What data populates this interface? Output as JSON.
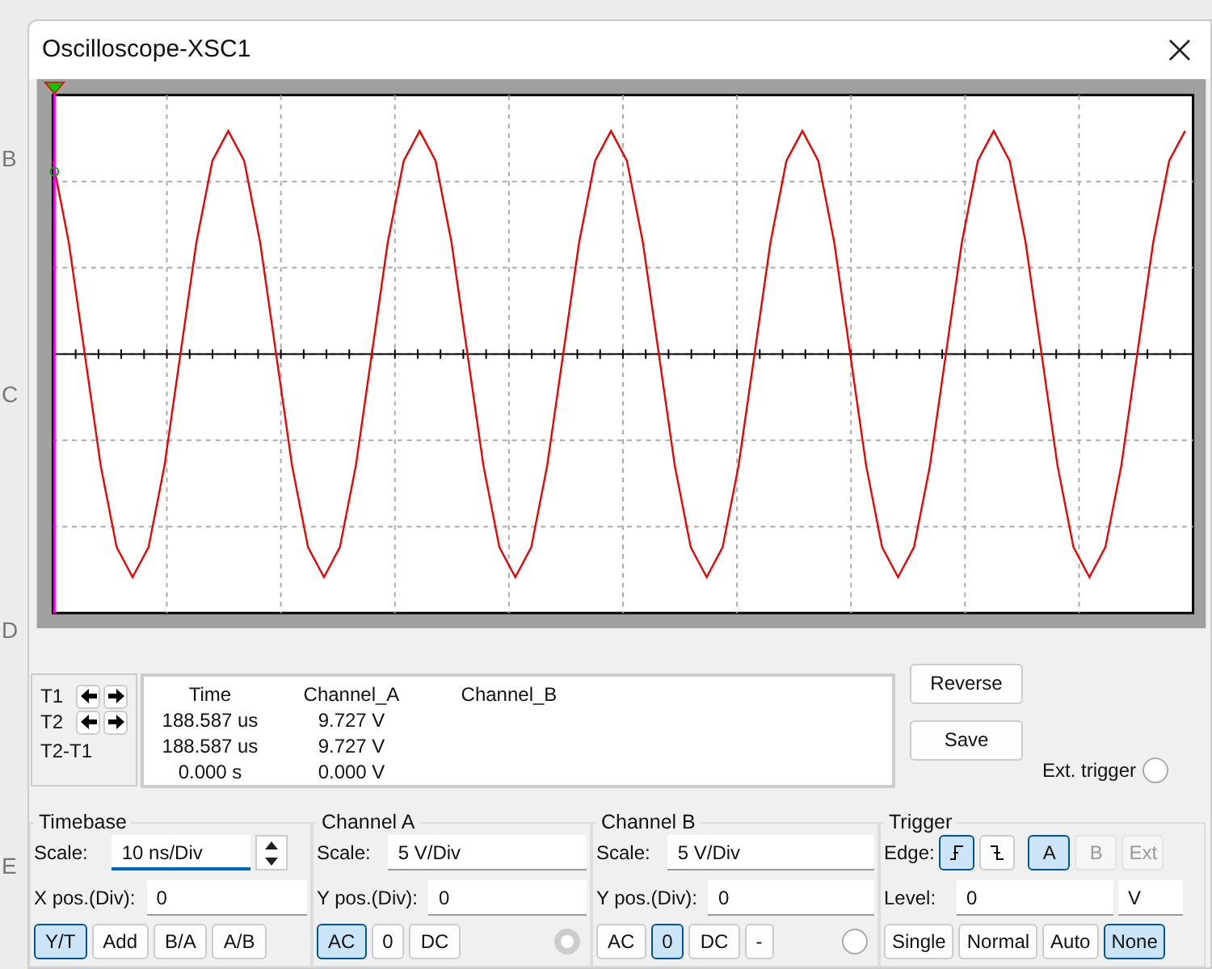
{
  "background_labels": [
    "B",
    "C",
    "D",
    "E"
  ],
  "window": {
    "title": "Oscilloscope-XSC1"
  },
  "cursors": [
    {
      "label": "T1"
    },
    {
      "label": "T2"
    }
  ],
  "cursor_diff_label": "T2-T1",
  "readout": {
    "columns": [
      "Time",
      "Channel_A",
      "Channel_B"
    ],
    "rows": [
      [
        "188.587 us",
        "9.727 V"
      ],
      [
        "188.587 us",
        "9.727 V"
      ],
      [
        "0.000 s",
        "0.000 V"
      ]
    ]
  },
  "buttons": [
    "Reverse",
    "Save"
  ],
  "ext_trigger": {
    "label": "Ext. trigger",
    "selected": false
  },
  "timebase": {
    "title": "Timebase",
    "scale_label": "Scale:",
    "scale": "10 ns/Div",
    "xpos_label": "X pos.(Div):",
    "xpos": "0",
    "modes": [
      {
        "label": "Y/T",
        "selected": true
      },
      {
        "label": "Add",
        "selected": false
      },
      {
        "label": "B/A",
        "selected": false
      },
      {
        "label": "A/B",
        "selected": false
      }
    ]
  },
  "channels": [
    {
      "title": "Channel A",
      "scale_label": "Scale:",
      "scale": "5  V/Div",
      "ypos_label": "Y pos.(Div):",
      "ypos": "0",
      "terminal_connected": true,
      "coupling": [
        {
          "label": "AC",
          "selected": true
        },
        {
          "label": "0",
          "selected": false
        },
        {
          "label": "DC",
          "selected": false
        }
      ]
    },
    {
      "title": "Channel B",
      "scale_label": "Scale:",
      "scale": "5  V/Div",
      "ypos_label": "Y pos.(Div):",
      "ypos": "0",
      "terminal_connected": false,
      "coupling": [
        {
          "label": "AC",
          "selected": false
        },
        {
          "label": "0",
          "selected": true
        },
        {
          "label": "DC",
          "selected": false
        },
        {
          "label": "-",
          "selected": false
        }
      ]
    }
  ],
  "trigger": {
    "title": "Trigger",
    "edge_label": "Edge:",
    "edges": [
      {
        "kind": "rising",
        "selected": true
      },
      {
        "kind": "falling",
        "selected": false
      }
    ],
    "sources": [
      {
        "label": "A",
        "selected": true,
        "disabled": false
      },
      {
        "label": "B",
        "selected": false,
        "disabled": true
      },
      {
        "label": "Ext",
        "selected": false,
        "disabled": true
      }
    ],
    "level_label": "Level:",
    "level": "0",
    "unit": "V",
    "modes": [
      {
        "label": "Single",
        "selected": false
      },
      {
        "label": "Normal",
        "selected": false
      },
      {
        "label": "Auto",
        "selected": false
      },
      {
        "label": "None",
        "selected": true
      }
    ]
  }
}
